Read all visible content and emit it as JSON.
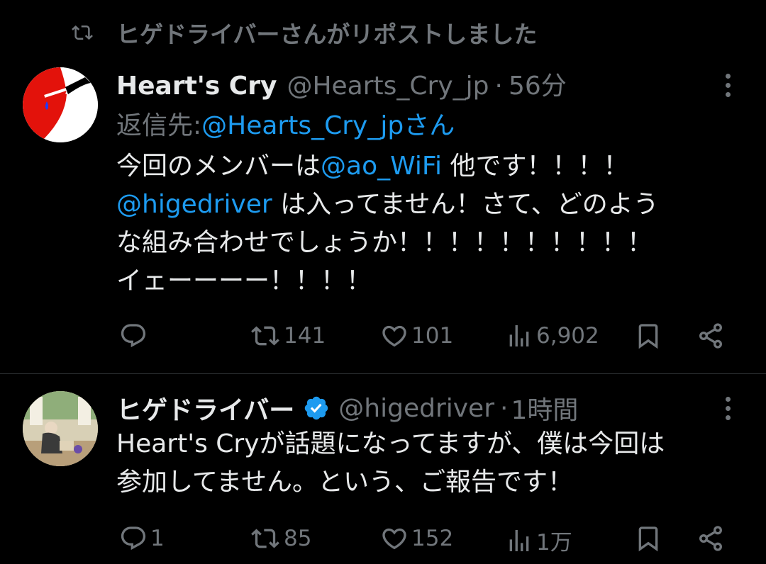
{
  "repost_banner": {
    "text": "ヒゲドライバーさんがリポストしました",
    "icon": "repost-icon"
  },
  "tweets": [
    {
      "display_name": "Heart's Cry",
      "handle": "@Hearts_Cry_jp",
      "separator": "·",
      "time": "56分",
      "reply_prefix": "返信先: ",
      "reply_to": "@Hearts_Cry_jpさん",
      "lines": [
        [
          {
            "t": "今回のメンバーは",
            "link": false
          },
          {
            "t": "@ao_WiFi",
            "link": true
          },
          {
            "t": " 他です！！！！",
            "link": false
          }
        ],
        [
          {
            "t": "@higedriver",
            "link": true
          },
          {
            "t": " は入ってません！さて、どのよう",
            "link": false
          }
        ],
        [
          {
            "t": "な組み合わせでしょうか！！！！！！！！！！",
            "link": false
          }
        ],
        [
          {
            "t": "イェーーーー！！！！",
            "link": false
          }
        ]
      ],
      "actions": {
        "reply": "",
        "repost": "141",
        "like": "101",
        "views": "6,902"
      }
    },
    {
      "display_name": "ヒゲドライバー",
      "verified": true,
      "handle": "@higedriver",
      "separator": "·",
      "time": "1時間",
      "lines": [
        [
          {
            "t": "Heart's Cryが話題になってますが、僕は今回は",
            "link": false
          }
        ],
        [
          {
            "t": "参加してません。という、ご報告です！",
            "link": false
          }
        ]
      ],
      "actions": {
        "reply": "1",
        "repost": "85",
        "like": "152",
        "views": "1万"
      }
    }
  ],
  "colors": {
    "background": "#000000",
    "text": "#e7e9ea",
    "muted": "#71767b",
    "link": "#1d9bf0",
    "divider": "#2f3336"
  }
}
